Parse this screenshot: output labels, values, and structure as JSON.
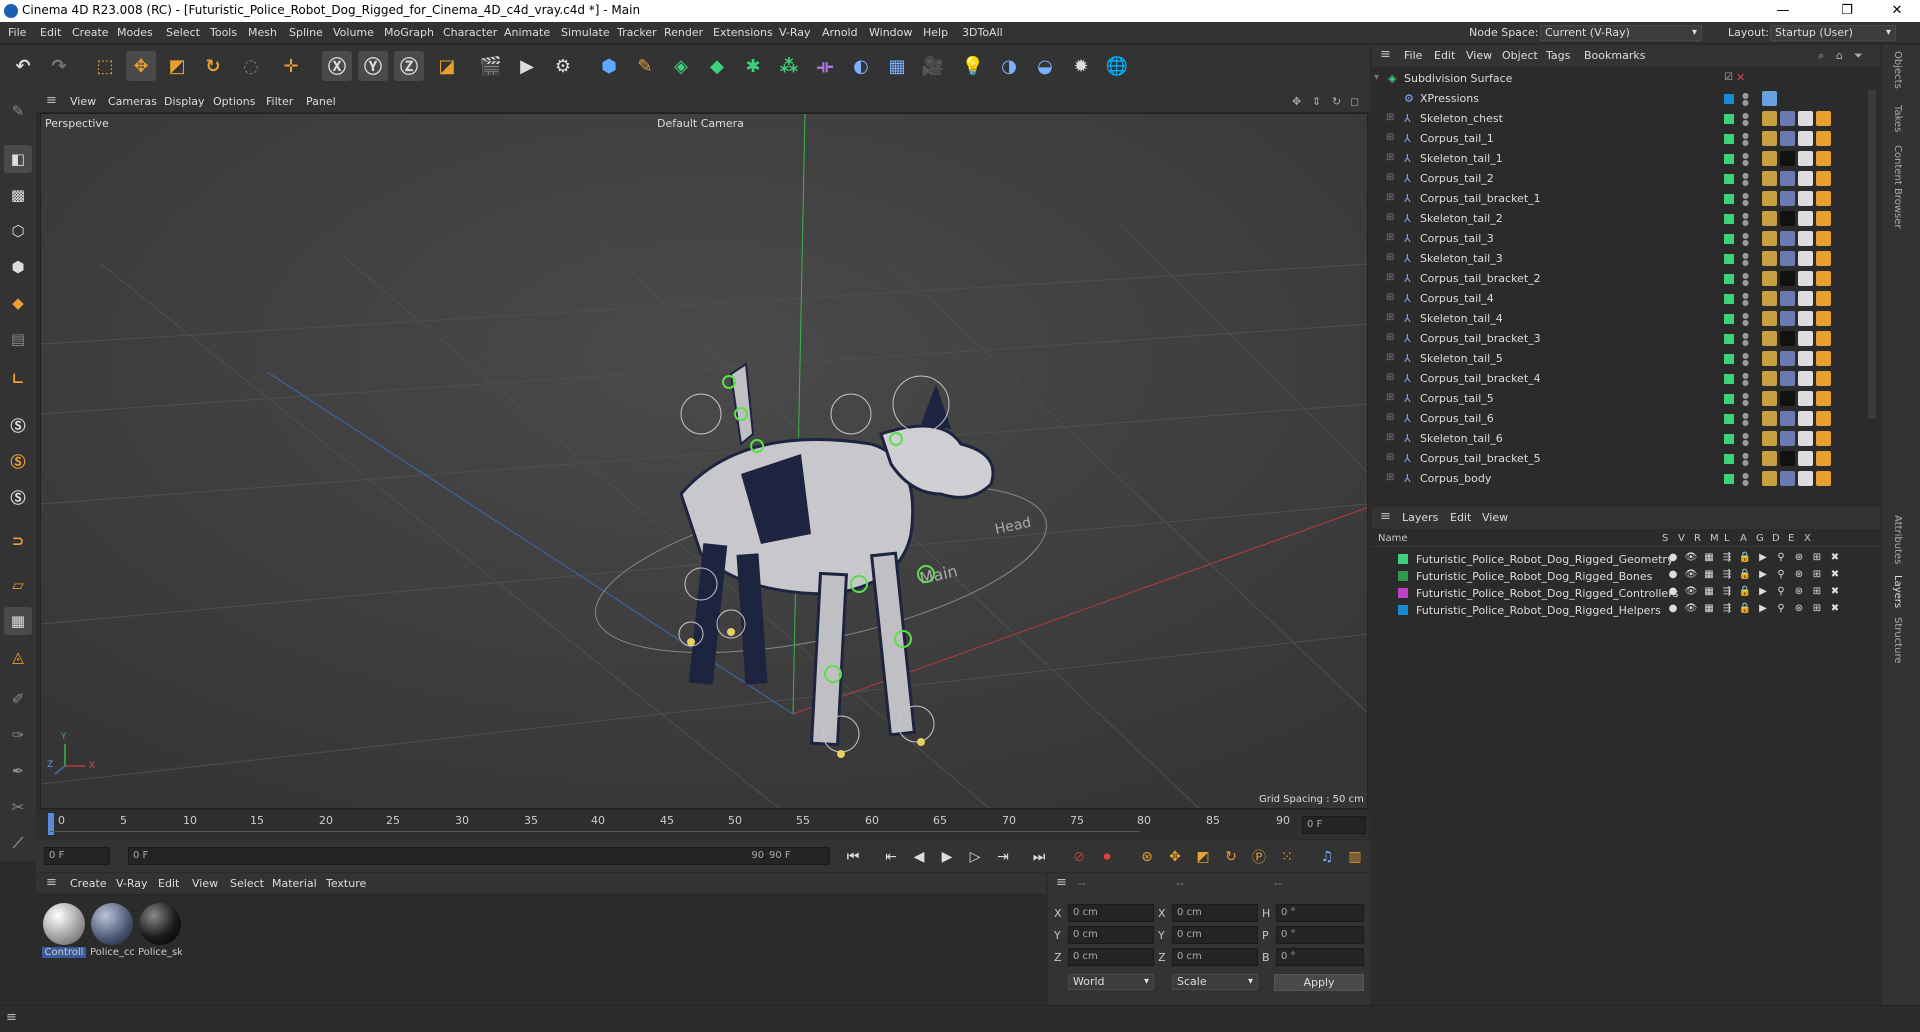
{
  "window": {
    "title": "Cinema 4D R23.008 (RC) - [Futuristic_Police_Robot_Dog_Rigged_for_Cinema_4D_c4d_vray.c4d *] - Main",
    "minimize": "—",
    "maximize": "❐",
    "close": "✕"
  },
  "menubar": {
    "items": [
      "File",
      "Edit",
      "Create",
      "Modes",
      "Select",
      "Tools",
      "Mesh",
      "Spline",
      "Volume",
      "MoGraph",
      "Character",
      "Animate",
      "Simulate",
      "Tracker",
      "Render",
      "Extensions",
      "V-Ray",
      "Arnold",
      "Window",
      "Help",
      "3DToAll"
    ],
    "node_space_label": "Node Space:",
    "node_space_value": "Current (V-Ray)",
    "layout_label": "Layout:",
    "layout_value": "Startup (User)"
  },
  "viewport": {
    "menu": [
      "View",
      "Cameras",
      "Display",
      "Options",
      "Filter",
      "Panel"
    ],
    "view_name": "Perspective",
    "camera": "Default Camera",
    "grid_spacing": "Grid Spacing : 50 cm",
    "axis_y": "Y",
    "axis_x": "X",
    "axis_z": "Z",
    "rig_labels": [
      "Head",
      "Main"
    ]
  },
  "timeline": {
    "ticks": [
      "0",
      "5",
      "10",
      "15",
      "20",
      "25",
      "30",
      "35",
      "40",
      "45",
      "50",
      "55",
      "60",
      "65",
      "70",
      "75",
      "80",
      "85",
      "90"
    ],
    "current_frame": "0 F"
  },
  "transport": {
    "start_field": "0 F",
    "range_start": "0 F",
    "range_end": "90 F",
    "end_field": "90 F"
  },
  "material_manager": {
    "menu": [
      "Create",
      "V-Ray",
      "Edit",
      "View",
      "Select",
      "Material",
      "Texture"
    ],
    "materials": [
      {
        "name": "Controll",
        "color": "#cfcfcf"
      },
      {
        "name": "Police_cc",
        "color": "#4a5470"
      },
      {
        "name": "Police_sk",
        "color": "#1a1a1a"
      }
    ]
  },
  "coordinates": {
    "header": [
      "--",
      "--",
      "--"
    ],
    "rows": [
      {
        "a": "X",
        "av": "0 cm",
        "b": "X",
        "bv": "0 cm",
        "c": "H",
        "cv": "0 °"
      },
      {
        "a": "Y",
        "av": "0 cm",
        "b": "Y",
        "bv": "0 cm",
        "c": "P",
        "cv": "0 °"
      },
      {
        "a": "Z",
        "av": "0 cm",
        "b": "Z",
        "bv": "0 cm",
        "c": "B",
        "cv": "0 °"
      }
    ],
    "space": "World",
    "mode": "Scale",
    "apply": "Apply"
  },
  "object_manager": {
    "menu": [
      "File",
      "Edit",
      "View",
      "Object",
      "Tags",
      "Bookmarks"
    ],
    "root": "Subdivision Surface",
    "objects": [
      "XPressions",
      "Skeleton_chest",
      "Corpus_tail_1",
      "Skeleton_tail_1",
      "Corpus_tail_2",
      "Corpus_tail_bracket_1",
      "Skeleton_tail_2",
      "Corpus_tail_3",
      "Skeleton_tail_3",
      "Corpus_tail_bracket_2",
      "Corpus_tail_4",
      "Skeleton_tail_4",
      "Corpus_tail_bracket_3",
      "Skeleton_tail_5",
      "Corpus_tail_bracket_4",
      "Corpus_tail_5",
      "Corpus_tail_6",
      "Skeleton_tail_6",
      "Corpus_tail_bracket_5",
      "Corpus_body"
    ]
  },
  "layer_manager": {
    "menu": [
      "Layers",
      "Edit",
      "View"
    ],
    "columns": [
      "Name",
      "S",
      "V",
      "R",
      "M",
      "L",
      "A",
      "G",
      "D",
      "E",
      "X"
    ],
    "layers": [
      {
        "name": "Futuristic_Police_Robot_Dog_Rigged_Geometry",
        "color": "#3cd27a"
      },
      {
        "name": "Futuristic_Police_Robot_Dog_Rigged_Bones",
        "color": "#2e9a4a"
      },
      {
        "name": "Futuristic_Police_Robot_Dog_Rigged_Controllers",
        "color": "#c040c8"
      },
      {
        "name": "Futuristic_Police_Robot_Dog_Rigged_Helpers",
        "color": "#1a8ad8"
      }
    ]
  },
  "right_tabs": [
    "Objects",
    "Takes",
    "Content Browser",
    "Attributes",
    "Layers",
    "Structure"
  ]
}
